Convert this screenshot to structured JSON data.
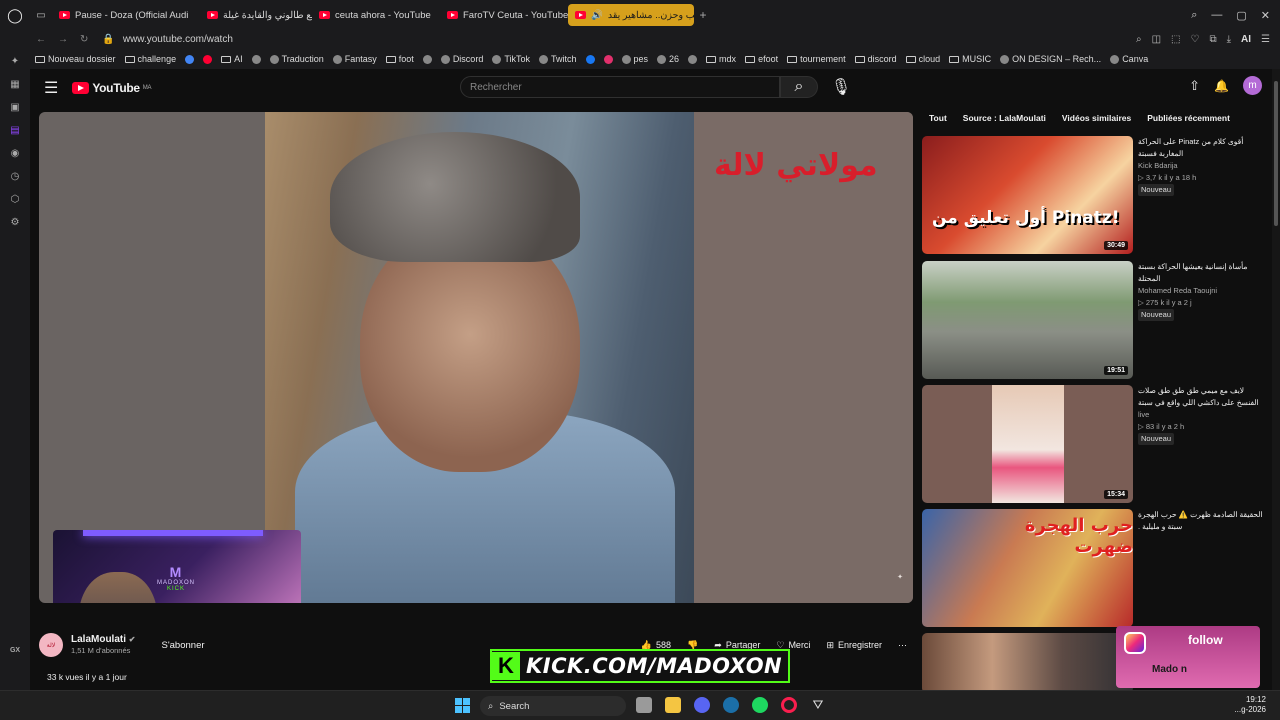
{
  "browser": {
    "tabs": [
      {
        "label": "Pause - Doza (Official Audi",
        "icon": "youtube-icon"
      },
      {
        "label": "لايف مع طالوني والقايدة غيلة",
        "icon": "youtube-icon"
      },
      {
        "label": "ceuta ahora - YouTube",
        "icon": "youtube-icon"
      },
      {
        "label": "FaroTV Ceuta - YouTube",
        "icon": "youtube-icon"
      },
      {
        "label": "غضب وحزن.. مشاهير يقد",
        "icon": "youtube-icon",
        "active": true
      }
    ],
    "new_tab": "+",
    "url": "www.youtube.com/watch",
    "ai_label": "AI",
    "accent_color": "#d6a01c"
  },
  "bookmarks": [
    {
      "label": "Nouveau dossier",
      "type": "folder"
    },
    {
      "label": "challenge",
      "type": "folder"
    },
    {
      "label": "",
      "type": "google"
    },
    {
      "label": "",
      "type": "youtube"
    },
    {
      "label": "AI",
      "type": "folder"
    },
    {
      "label": "",
      "type": "site"
    },
    {
      "label": "Traduction",
      "type": "site"
    },
    {
      "label": "Fantasy",
      "type": "site"
    },
    {
      "label": "foot",
      "type": "folder"
    },
    {
      "label": "",
      "type": "site"
    },
    {
      "label": "Discord",
      "type": "site"
    },
    {
      "label": "TikTok",
      "type": "site"
    },
    {
      "label": "Twitch",
      "type": "site"
    },
    {
      "label": "",
      "type": "facebook"
    },
    {
      "label": "",
      "type": "instagram"
    },
    {
      "label": "pes",
      "type": "site"
    },
    {
      "label": "26",
      "type": "site"
    },
    {
      "label": "",
      "type": "site"
    },
    {
      "label": "mdx",
      "type": "folder"
    },
    {
      "label": "efoot",
      "type": "folder"
    },
    {
      "label": "tournement",
      "type": "folder"
    },
    {
      "label": "discord",
      "type": "folder"
    },
    {
      "label": "cloud",
      "type": "folder"
    },
    {
      "label": "MUSIC",
      "type": "folder"
    },
    {
      "label": "ON DESIGN – Rech...",
      "type": "site"
    },
    {
      "label": "Canva",
      "type": "site"
    }
  ],
  "sidebar": {
    "bottom_label": "GX"
  },
  "youtube": {
    "logo_text": "YouTube",
    "logo_region": "MA",
    "search_placeholder": "Rechercher",
    "avatar_letter": "m",
    "video": {
      "channel_overlay_text": "مولاتي لالة",
      "webcam_brand": "MADOXON",
      "webcam_brand_sub": "KICK",
      "kick_banner": "KICK.COM/MADOXON",
      "kick_letter": "K"
    },
    "channel": {
      "name": "LalaMoulati",
      "subscribers": "1,51 M d'abonnés",
      "subscribe": "S'abonner"
    },
    "actions": {
      "likes": "588",
      "share": "Partager",
      "thanks": "Merci",
      "save": "Enregistrer",
      "more": "⋯"
    },
    "description_line": "33 k vues  il y a 1 jour",
    "filters": [
      "Tout",
      "Source : LalaMoulati",
      "Vidéos similaires",
      "Publiées récemment"
    ],
    "recommendations": [
      {
        "title": "أقوى كلام من Pinatz على الحراكة المغاربة فسبتة",
        "channel": "Kick Bdarija",
        "stats": "▷ 3,7 k  il y a 18 h",
        "badge": "Nouveau",
        "duration": "30:49",
        "thumb_text": "أول تعليق من Pinatz!"
      },
      {
        "title": "مأساة إنسانية يعيشها الحراكة بسبتة المحتلة",
        "channel": "Mohamed Reda Taoujni",
        "stats": "▷ 275 k  il y a 2 j",
        "badge": "Nouveau",
        "duration": "19:51",
        "thumb_text": ""
      },
      {
        "title": "لايف مع ميمي طق طق طق صلات الفنسخ على داكشي اللي واقع في سبتة",
        "channel": "live",
        "stats": "▷ 83  il y a 2 h",
        "badge": "Nouveau",
        "duration": "15:34",
        "thumb_text": ""
      },
      {
        "title": "الحقيقة الصادمة ظهرت ⚠️ حرب الهجرة سبتة و مليلية .",
        "channel": "",
        "stats": "",
        "badge": "",
        "duration": "",
        "thumb_text": "حرب الهجرة ضهرت"
      }
    ],
    "follow_overlay": {
      "text": "follow",
      "name": "Mado n"
    }
  },
  "taskbar": {
    "search": "Search",
    "time": "19:12",
    "date": "...g-2026"
  }
}
